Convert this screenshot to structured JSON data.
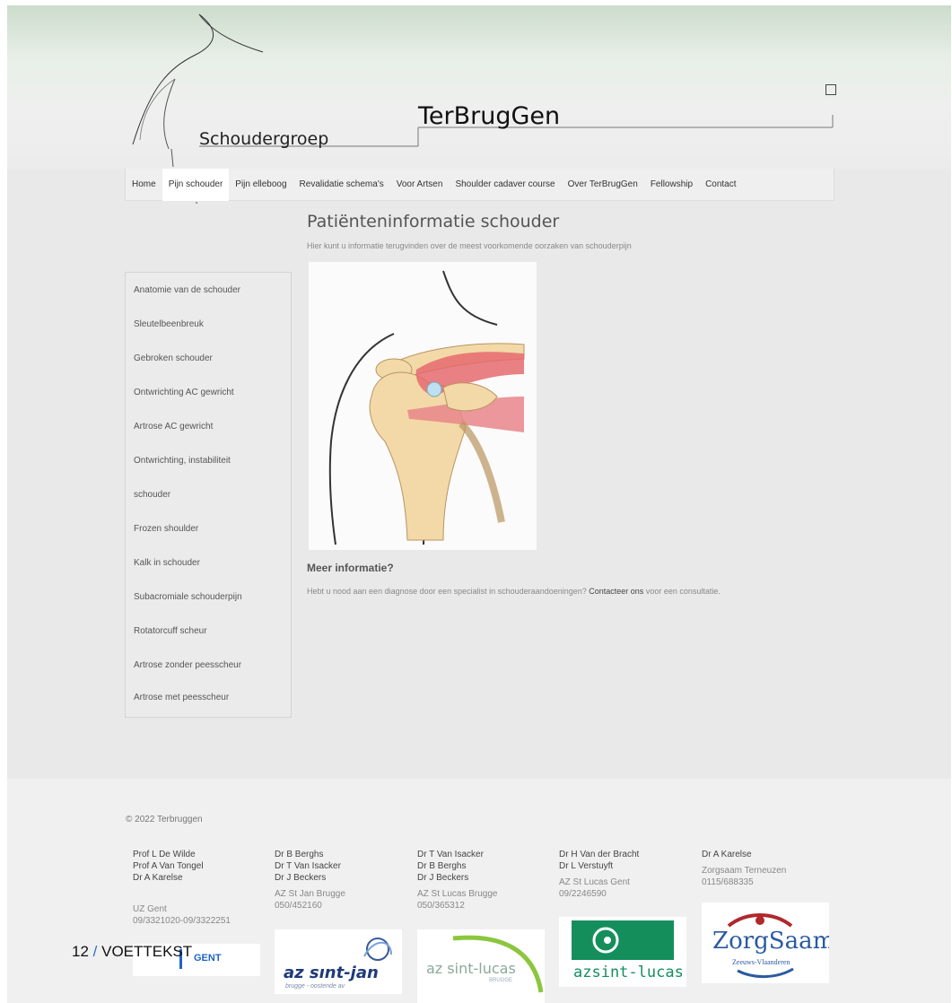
{
  "brand": {
    "sub": "Schoudergroep",
    "main": "TerBrugGen"
  },
  "nav": [
    {
      "label": "Home"
    },
    {
      "label": "Pijn schouder",
      "active": true
    },
    {
      "label": "Pijn elleboog"
    },
    {
      "label": "Revalidatie schema's"
    },
    {
      "label": "Voor Artsen"
    },
    {
      "label": "Shoulder cadaver course"
    },
    {
      "label": "Over TerBrugGen"
    },
    {
      "label": "Fellowship"
    },
    {
      "label": "Contact"
    }
  ],
  "main": {
    "title": "Patiënteninformatie schouder",
    "intro": "Hier kunt u informatie terugvinden over de meest voorkomende oorzaken van schouderpijn",
    "more_heading": "Meer informatie?",
    "more_text": "Hebt u nood aan een diagnose door een specialist in schouderaandoeningen?",
    "more_link": "Contacteer ons",
    "more_text_end": "voor een consultatie."
  },
  "sidebar": {
    "items": [
      "Anatomie van de schouder",
      "Sleutelbeenbreuk",
      "Gebroken schouder",
      "Ontwrichting AC gewricht",
      "Artrose AC gewricht",
      "Ontwrichting, instabiliteit",
      "schouder",
      "Frozen shoulder",
      "Kalk in schouder",
      "Subacromiale schouderpijn",
      "Rotatorcuff scheur",
      "Artrose zonder peesscheur",
      "Artrose met peesscheur"
    ]
  },
  "footer": {
    "copyright": "© 2022 Terbruggen",
    "columns": [
      {
        "doctors": [
          "Prof L De Wilde",
          "Prof A Van Tongel",
          "Dr A Karelse"
        ],
        "hospital": "UZ Gent",
        "phone": "09/3321020-09/3322251"
      },
      {
        "doctors": [
          "Dr B Berghs",
          "Dr T Van Isacker",
          "Dr J Beckers"
        ],
        "hospital": "AZ St Jan Brugge",
        "phone": "050/452160"
      },
      {
        "doctors": [
          "Dr T Van Isacker",
          "Dr B Berghs",
          "Dr J Beckers"
        ],
        "hospital": "AZ St Lucas Brugge",
        "phone": "050/365312"
      },
      {
        "doctors": [
          "Dr H Van der Bracht",
          "Dr L Verstuyft"
        ],
        "hospital": "AZ St Lucas Gent",
        "phone": "09/2246590"
      },
      {
        "doctors": [
          "Dr A Karelse"
        ],
        "hospital": "Zorgsaam Terneuzen",
        "phone": "0115/688335"
      }
    ],
    "logos": {
      "uz": "GENT",
      "stjan_main": "az sınt-jan",
      "stjan_sub": "brugge - oostende av",
      "stlucas_brugge_main": "az sint-lucas",
      "stlucas_brugge_sub": "BRUGGE",
      "stlucas_gent": "azsint-lucas",
      "zorgsaam_main": "ZorgSaam",
      "zorgsaam_sub": "Zeeuws-Vlaanderen"
    }
  },
  "overlay": {
    "page_num": "12",
    "sep": "/",
    "label": "VOETTEKST"
  }
}
